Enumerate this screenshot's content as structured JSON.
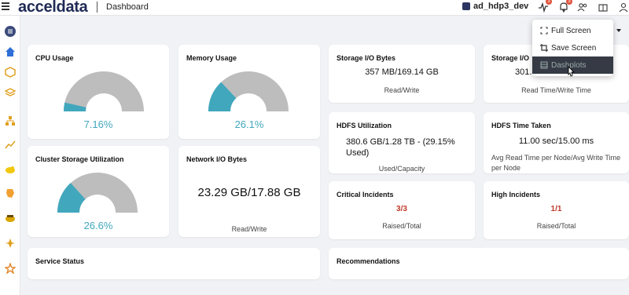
{
  "app": {
    "logo": "acceldata",
    "page_title": "Dashboard",
    "cluster": "ad_hdp3_dev"
  },
  "topbar": {
    "icons": [
      {
        "name": "activity-icon",
        "badge": "3"
      },
      {
        "name": "bell-icon",
        "badge": "3"
      },
      {
        "name": "users-icon"
      },
      {
        "name": "box-icon"
      },
      {
        "name": "user-icon"
      }
    ]
  },
  "dropdown": {
    "items": [
      {
        "label": "Full Screen",
        "icon": "fullscreen-icon"
      },
      {
        "label": "Save Screen",
        "icon": "crop-icon"
      },
      {
        "label": "Dashplots",
        "icon": "dashplots-icon"
      }
    ]
  },
  "cards": {
    "cpu": {
      "title": "CPU Usage",
      "value": "7.16%",
      "percent": 7.16
    },
    "memory": {
      "title": "Memory Usage",
      "value": "26.1%",
      "percent": 26.1
    },
    "cluster_storage": {
      "title": "Cluster Storage Utilization",
      "value": "26.6%",
      "percent": 26.6
    },
    "network": {
      "title": "Network I/O Bytes",
      "value": "23.29 GB/17.88 GB",
      "sub": "Read/Write"
    },
    "storage_io_bytes": {
      "title": "Storage I/O Bytes",
      "value": "357 MB/169.14 GB",
      "sub": "Read/Write"
    },
    "storage_io_time": {
      "title": "Storage I/O",
      "value": "301.8",
      "sub": "Read Time/Write Time"
    },
    "hdfs_util": {
      "title": "HDFS Utilization",
      "value_line1": "380.6 GB/1.28 TB - (29.15%",
      "value_line2": "Used)",
      "sub": "Used/Capacity"
    },
    "hdfs_time": {
      "title": "HDFS Time Taken",
      "value": "11.00 sec/15.00 ms",
      "sub_line1": "Avg Read Time per Node/Avg Write Time",
      "sub_line2": "per Node"
    },
    "critical": {
      "title": "Critical Incidents",
      "value": "3/3",
      "sub": "Raised/Total"
    },
    "high": {
      "title": "High Incidents",
      "value": "1/1",
      "sub": "Raised/Total"
    },
    "service_status": {
      "title": "Service Status"
    },
    "recommendations": {
      "title": "Recommendations"
    }
  },
  "colors": {
    "gauge_fill": "#41a7bd",
    "gauge_track": "#bdbdbd",
    "incident_red": "#c0392b"
  }
}
